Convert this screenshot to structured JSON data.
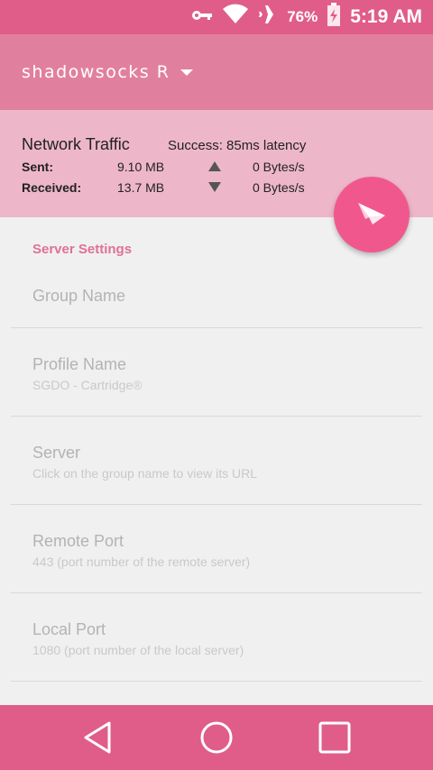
{
  "status_bar": {
    "battery_percent": "76%",
    "time": "5:19 AM",
    "icons": [
      "vpn-key-icon",
      "wifi-icon",
      "airplane-icon",
      "battery-charging-icon"
    ]
  },
  "app_bar": {
    "title": "shadowsocks R"
  },
  "traffic": {
    "heading": "Network Traffic",
    "latency": "Success: 85ms latency",
    "sent_label": "Sent:",
    "sent_total": "9.10 MB",
    "sent_rate": "0 Bytes/s",
    "received_label": "Received:",
    "received_total": "13.7 MB",
    "received_rate": "0 Bytes/s"
  },
  "settings": {
    "section_title": "Server Settings",
    "items": [
      {
        "title": "Group Name",
        "summary": ""
      },
      {
        "title": "Profile Name",
        "summary": "SGDO - Cartridge®"
      },
      {
        "title": "Server",
        "summary": "Click on the group name to view its URL"
      },
      {
        "title": "Remote Port",
        "summary": "443 (port number of the remote server)"
      },
      {
        "title": "Local Port",
        "summary": "1080 (port number of the local server)"
      }
    ]
  },
  "colors": {
    "status_bar": "#e05d89",
    "app_bar": "#e1809e",
    "traffic_panel": "#eeb7c9",
    "fab": "#f0588d",
    "section_title": "#e07098",
    "nav_bar": "#e05d89"
  }
}
